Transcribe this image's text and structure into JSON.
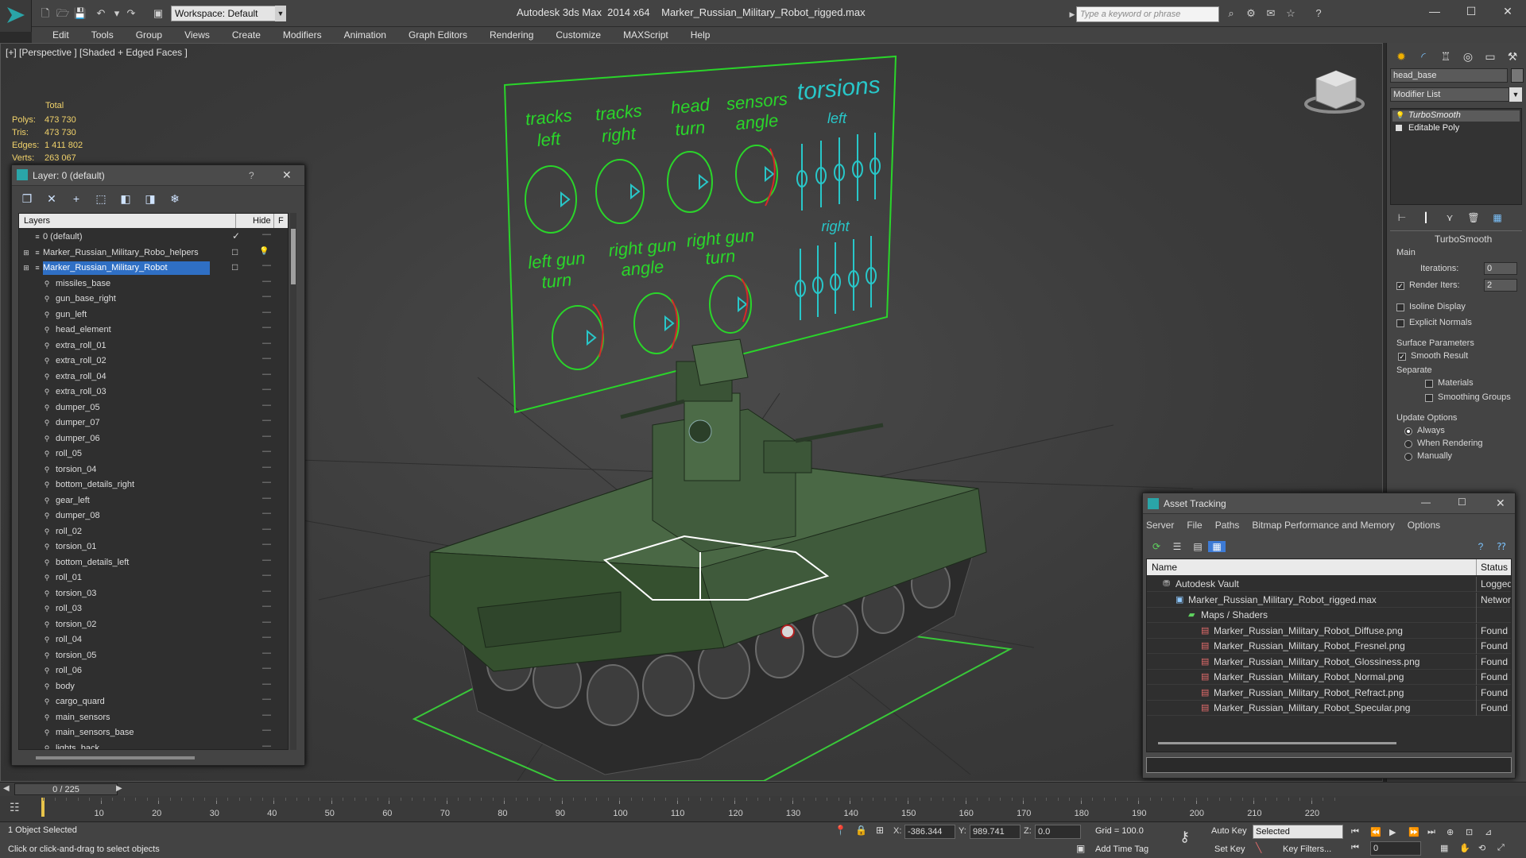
{
  "titlebar": {
    "workspace": "Workspace: Default",
    "app_name": "Autodesk 3ds Max  2014 x64",
    "file_name": "Marker_Russian_Military_Robot_rigged.max",
    "search_placeholder": "Type a keyword or phrase"
  },
  "menu": [
    "Edit",
    "Tools",
    "Group",
    "Views",
    "Create",
    "Modifiers",
    "Animation",
    "Graph Editors",
    "Rendering",
    "Customize",
    "MAXScript",
    "Help"
  ],
  "viewport": {
    "label": "[+] [Perspective ] [Shaded + Edged Faces ]",
    "stats": {
      "total_label": "Total",
      "polys_label": "Polys:",
      "polys": "473 730",
      "tris_label": "Tris:",
      "tris": "473 730",
      "edges_label": "Edges:",
      "edges": "1 411 802",
      "verts_label": "Verts:",
      "verts": "263 067"
    },
    "board": {
      "tracks_left": [
        "tracks",
        "left"
      ],
      "tracks_right": [
        "tracks",
        "right"
      ],
      "head_turn": [
        "head",
        "turn"
      ],
      "sensors_angle": [
        "sensors",
        "angle"
      ],
      "torsions": "torsions",
      "torsions_left": "left",
      "torsions_right": "right",
      "left_gun_turn": [
        "left gun",
        "turn"
      ],
      "right_gun_angle": [
        "right gun",
        "angle"
      ],
      "right_gun_turn": [
        "right gun",
        "turn"
      ]
    }
  },
  "layer_window": {
    "title": "Layer: 0 (default)",
    "help": "?",
    "col_layers": "Layers",
    "col_hide": "Hide",
    "col_freeze": "F",
    "layers": [
      {
        "name": "0 (default)",
        "level": 0,
        "check": "✓"
      },
      {
        "name": "Marker_Russian_Military_Robo_helpers",
        "level": 0,
        "check": "□"
      },
      {
        "name": "Marker_Russian_Military_Robot",
        "level": 0,
        "check": "□",
        "selected": true
      }
    ],
    "objects": [
      "missiles_base",
      "gun_base_right",
      "gun_left",
      "head_element",
      "extra_roll_01",
      "extra_roll_02",
      "extra_roll_04",
      "extra_roll_03",
      "dumper_05",
      "dumper_07",
      "dumper_06",
      "roll_05",
      "torsion_04",
      "bottom_details_right",
      "gear_left",
      "dumper_08",
      "roll_02",
      "torsion_01",
      "bottom_details_left",
      "roll_01",
      "torsion_03",
      "roll_03",
      "torsion_02",
      "roll_04",
      "torsion_05",
      "roll_06",
      "body",
      "cargo_quard",
      "main_sensors",
      "main_sensors_base",
      "lights_back"
    ]
  },
  "cmd_panel": {
    "object_name": "head_base",
    "modifier_list": "Modifier List",
    "stack": [
      "TurboSmooth",
      "Editable Poly"
    ],
    "rollout_title": "TurboSmooth",
    "main": "Main",
    "iterations_label": "Iterations:",
    "iterations": "0",
    "render_iters_label": "Render Iters:",
    "render_iters": "2",
    "isoline": "Isoline Display",
    "explicit_normals": "Explicit Normals",
    "surface_params": "Surface Parameters",
    "smooth_result": "Smooth Result",
    "separate": "Separate",
    "materials": "Materials",
    "smoothing_groups": "Smoothing Groups",
    "update_options": "Update Options",
    "always": "Always",
    "when_rendering": "When Rendering",
    "manually": "Manually"
  },
  "asset_tracking": {
    "title": "Asset Tracking",
    "menu": [
      "Server",
      "File",
      "Paths",
      "Bitmap Performance and Memory",
      "Options"
    ],
    "col_name": "Name",
    "col_status": "Status",
    "rows": [
      {
        "name": "Autodesk Vault",
        "status": "Logged",
        "indent": 0
      },
      {
        "name": "Marker_Russian_Military_Robot_rigged.max",
        "status": "Network",
        "indent": 1
      },
      {
        "name": "Maps / Shaders",
        "status": "",
        "indent": 2
      },
      {
        "name": "Marker_Russian_Military_Robot_Diffuse.png",
        "status": "Found",
        "indent": 3
      },
      {
        "name": "Marker_Russian_Military_Robot_Fresnel.png",
        "status": "Found",
        "indent": 3
      },
      {
        "name": "Marker_Russian_Military_Robot_Glossiness.png",
        "status": "Found",
        "indent": 3
      },
      {
        "name": "Marker_Russian_Military_Robot_Normal.png",
        "status": "Found",
        "indent": 3
      },
      {
        "name": "Marker_Russian_Military_Robot_Refract.png",
        "status": "Found",
        "indent": 3
      },
      {
        "name": "Marker_Russian_Military_Robot_Specular.png",
        "status": "Found",
        "indent": 3
      }
    ]
  },
  "timeline": {
    "frame": "0 / 225",
    "ticks": [
      "10",
      "20",
      "30",
      "40",
      "50",
      "60",
      "70",
      "80",
      "90",
      "100",
      "110",
      "120",
      "130",
      "140",
      "150",
      "160",
      "170",
      "180",
      "190",
      "200",
      "210",
      "220"
    ]
  },
  "statusbar": {
    "selection": "1 Object Selected",
    "prompt": "Click or click-and-drag to select objects",
    "x_label": "X:",
    "x": "-386.344",
    "y_label": "Y:",
    "y": "989.741",
    "z_label": "Z:",
    "z": "0.0",
    "grid": "Grid = 100.0",
    "auto_key": "Auto Key",
    "selected": "Selected",
    "set_key": "Set Key",
    "key_filters": "Key Filters...",
    "add_time_tag": "Add Time Tag",
    "frame_value": "0"
  }
}
